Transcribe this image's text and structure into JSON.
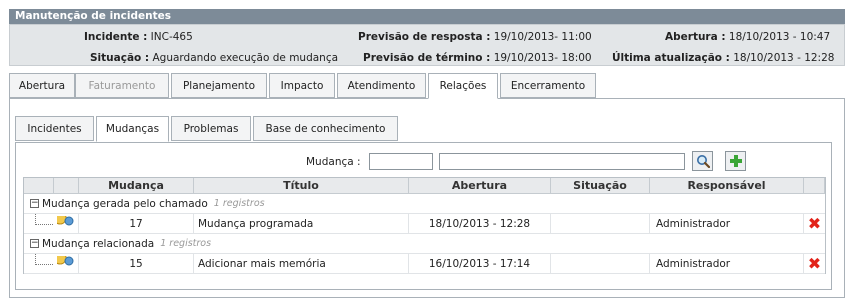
{
  "window": {
    "title": "Manutenção de incidentes"
  },
  "info": {
    "incidente_label": "Incidente :",
    "incidente_value": "INC-465",
    "situacao_label": "Situação :",
    "situacao_value": "Aguardando execução de mudança",
    "prev_resposta_label": "Previsão de resposta :",
    "prev_resposta_value": "19/10/2013- 11:00",
    "prev_termino_label": "Previsão de término :",
    "prev_termino_value": "19/10/2013- 18:00",
    "abertura_label": "Abertura :",
    "abertura_value": "18/10/2013 - 10:47",
    "ultima_label": "Última atualização :",
    "ultima_value": "18/10/2013 - 12:28"
  },
  "tabs": [
    "Abertura",
    "Faturamento",
    "Planejamento",
    "Impacto",
    "Atendimento",
    "Relações",
    "Encerramento"
  ],
  "subtabs": [
    "Incidentes",
    "Mudanças",
    "Problemas",
    "Base de conhecimento"
  ],
  "filter": {
    "label": "Mudança :",
    "code_value": "",
    "desc_value": ""
  },
  "grid": {
    "columns": [
      "Mudança",
      "Título",
      "Abertura",
      "Situação",
      "Responsável"
    ],
    "groups": [
      {
        "name": "Mudança gerada pelo chamado",
        "count": "1 registros",
        "row": {
          "id": "17",
          "title": "Mudança programada",
          "opened": "18/10/2013 - 12:28",
          "status": "",
          "owner": "Administrador"
        }
      },
      {
        "name": "Mudança relacionada",
        "count": "1 registros",
        "row": {
          "id": "15",
          "title": "Adicionar mais memória",
          "opened": "16/10/2013 - 17:14",
          "status": "",
          "owner": "Administrador"
        }
      }
    ]
  },
  "icons": {
    "search": "search-icon",
    "add": "add-icon",
    "delete": "delete-icon",
    "change": "change-icon"
  },
  "colors": {
    "titlebar": "#7d8b98",
    "delete": "#e2231a",
    "add": "#3aa536"
  }
}
